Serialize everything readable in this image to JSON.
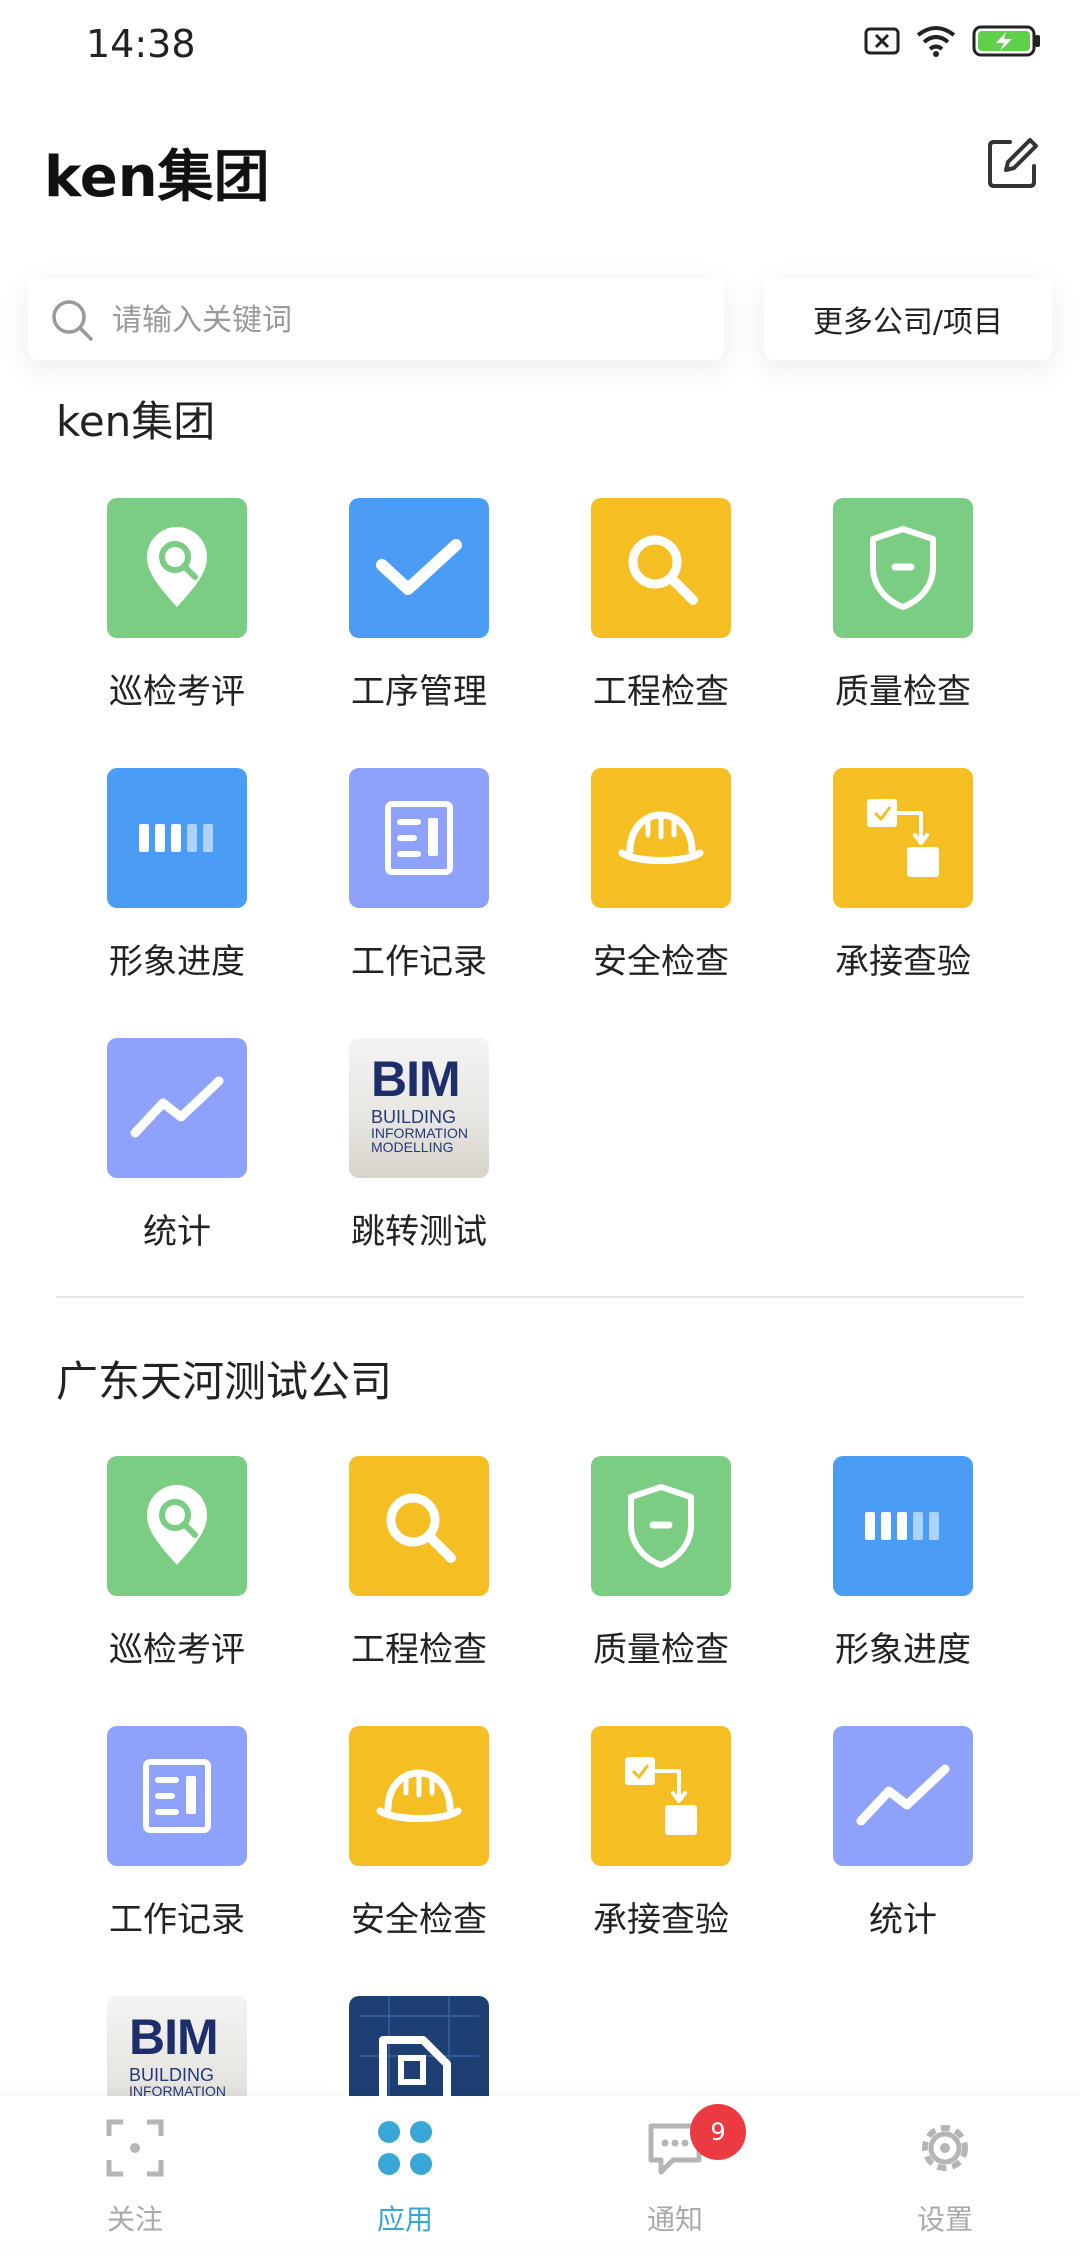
{
  "status": {
    "time": "14:38"
  },
  "header": {
    "title": "ken集团"
  },
  "search": {
    "placeholder": "请输入关键词",
    "more_label": "更多公司/项目"
  },
  "sections": [
    {
      "title": "ken集团",
      "apps": [
        {
          "label": "巡检考评",
          "icon": "location-pin-icon",
          "color": "#7bcd84"
        },
        {
          "label": "工序管理",
          "icon": "checkmark-icon",
          "color": "#4a9cf5"
        },
        {
          "label": "工程检查",
          "icon": "search-icon",
          "color": "#f5be22"
        },
        {
          "label": "质量检查",
          "icon": "shield-icon",
          "color": "#7bcd84"
        },
        {
          "label": "形象进度",
          "icon": "progress-bars-icon",
          "color": "#4a9cf5"
        },
        {
          "label": "工作记录",
          "icon": "notebook-icon",
          "color": "#8ea1fb"
        },
        {
          "label": "安全检查",
          "icon": "helmet-icon",
          "color": "#f5be22"
        },
        {
          "label": "承接查验",
          "icon": "flow-icon",
          "color": "#f5be22"
        },
        {
          "label": "统计",
          "icon": "trend-line-icon",
          "color": "#8ea1fb"
        },
        {
          "label": "跳转测试",
          "icon": "bim-image",
          "color": "#e8e6e2"
        }
      ]
    },
    {
      "title": "广东天河测试公司",
      "apps": [
        {
          "label": "巡检考评",
          "icon": "location-pin-icon",
          "color": "#7bcd84"
        },
        {
          "label": "工程检查",
          "icon": "search-icon",
          "color": "#f5be22"
        },
        {
          "label": "质量检查",
          "icon": "shield-icon",
          "color": "#7bcd84"
        },
        {
          "label": "形象进度",
          "icon": "progress-bars-icon",
          "color": "#4a9cf5"
        },
        {
          "label": "工作记录",
          "icon": "notebook-icon",
          "color": "#8ea1fb"
        },
        {
          "label": "安全检查",
          "icon": "helmet-icon",
          "color": "#f5be22"
        },
        {
          "label": "承接查验",
          "icon": "flow-icon",
          "color": "#f5be22"
        },
        {
          "label": "统计",
          "icon": "trend-line-icon",
          "color": "#8ea1fb"
        },
        {
          "label": "",
          "icon": "bim-image",
          "color": "#e8e6e2"
        },
        {
          "label": "",
          "icon": "document-icon",
          "color": "#1e3f73"
        }
      ]
    }
  ],
  "bim": {
    "title": "BIM",
    "line1": "BUILDING",
    "line2": "INFORMATION",
    "line3": "MODELLING"
  },
  "tabbar": {
    "tabs": [
      {
        "label": "关注",
        "icon": "focus-icon",
        "active": false
      },
      {
        "label": "应用",
        "icon": "apps-icon",
        "active": true
      },
      {
        "label": "通知",
        "icon": "message-icon",
        "active": false,
        "badge": "9"
      },
      {
        "label": "设置",
        "icon": "gear-icon",
        "active": false
      }
    ]
  },
  "colors": {
    "accent": "#3aa6d6",
    "badge": "#ec3a42"
  }
}
